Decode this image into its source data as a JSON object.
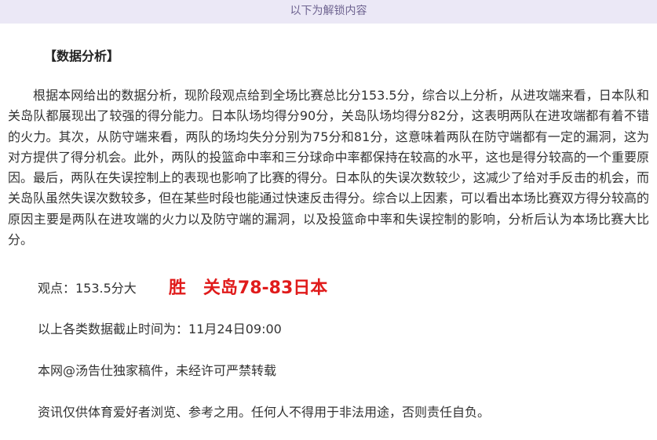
{
  "banner": {
    "text": "以下为解锁内容"
  },
  "article": {
    "heading": "【数据分析】",
    "paragraph": "根据本网给出的数据分析，现阶段观点给到全场比赛总比分153.5分，综合以上分析，从进攻端来看，日本队和关岛队都展现出了较强的得分能力。日本队场均得分90分，关岛队场均得分82分，这表明两队在进攻端都有着不错的火力。其次，从防守端来看，两队的场均失分分别为75分和81分，这意味着两队在防守端都有一定的漏洞，这为对方提供了得分机会。此外，两队的投篮命中率和三分球命中率都保持在较高的水平，这也是得分较高的一个重要原因。最后，两队在失误控制上的表现也影响了比赛的得分。日本队的失误次数较少，这减少了给对手反击的机会，而关岛队虽然失误次数较多，但在某些时段也能通过快速反击得分。综合以上因素，可以看出本场比赛双方得分较高的原因主要是两队在进攻端的火力以及防守端的漏洞，以及投篮命中率和失误控制的影响，分析后认为本场比赛大比分。",
    "view_label": "观点：153.5分大",
    "verdict_word": "胜",
    "verdict_score": "关岛78-83日本",
    "data_time": "以上各类数据截止时间为：11月24日09:00",
    "copyright": "本网@汤告仕独家稿件，未经许可严禁转载",
    "disclaimer": "资讯仅供体育爱好者浏览、参考之用。任何人不得用于非法用途，否则责任自负。"
  },
  "colors": {
    "banner_bg": "#ebe8f6",
    "banner_text": "#6e6390",
    "verdict": "#e01b1b",
    "body_text": "#333333"
  }
}
